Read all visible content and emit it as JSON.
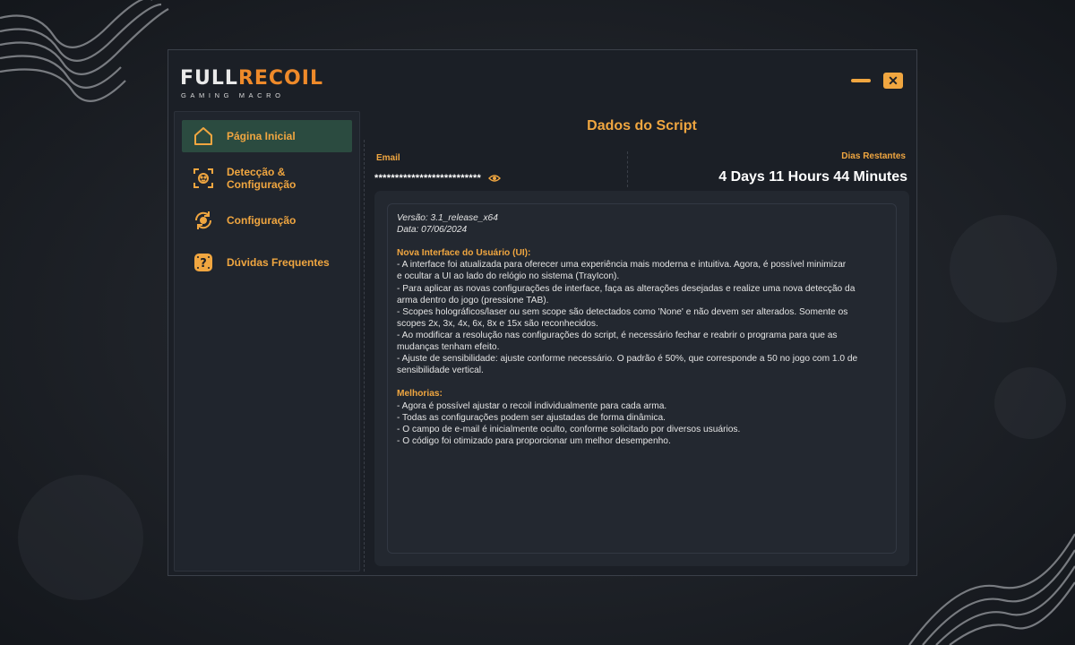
{
  "app": {
    "logo_full": "FULL",
    "logo_recoil": "RECOIL",
    "logo_sub": "GAMING MACRO",
    "close_symbol": "✕"
  },
  "sidebar": {
    "items": [
      {
        "label": "Página Inicial",
        "icon": "home-icon",
        "active": true
      },
      {
        "label": "Detecção & Configuração",
        "icon": "face-scan-icon",
        "active": false
      },
      {
        "label": "Configuração",
        "icon": "sync-gear-icon",
        "active": false
      },
      {
        "label": "Dúvidas Frequentes",
        "icon": "question-badge-icon",
        "active": false
      }
    ]
  },
  "main": {
    "title": "Dados do Script",
    "email_label": "Email",
    "email_value": "**************************",
    "days_label": "Dias Restantes",
    "days_value": "4 Days 11 Hours 44 Minutes",
    "notes": {
      "version": "Versão: 3.1_release_x64",
      "date": "Data: 07/06/2024",
      "ui_heading": "Nova Interface do Usuário (UI):",
      "ui_lines": [
        "- A interface foi atualizada para oferecer uma experiência mais moderna e intuitiva. Agora, é possível minimizar",
        "e ocultar a UI ao lado do relógio no sistema (TrayIcon).",
        "- Para aplicar as novas configurações de interface, faça as alterações desejadas e realize uma nova detecção da",
        "arma dentro do jogo (pressione TAB).",
        "- Scopes holográficos/laser ou sem scope são detectados como 'None' e não devem ser alterados. Somente os",
        "scopes 2x, 3x, 4x, 6x, 8x e 15x são reconhecidos.",
        "- Ao modificar a resolução nas configurações do script, é necessário fechar e reabrir o programa para que as",
        "mudanças tenham efeito.",
        "- Ajuste de sensibilidade: ajuste conforme necessário. O padrão é 50%, que corresponde a 50 no jogo com 1.0 de",
        "sensibilidade vertical."
      ],
      "improvements_heading": "Melhorias:",
      "improvement_lines": [
        "- Agora é possível ajustar o recoil individualmente para cada arma.",
        "- Todas as configurações podem ser ajustadas de forma dinâmica.",
        "- O campo de e-mail é inicialmente oculto, conforme solicitado por diversos usuários.",
        "- O código foi otimizado para proporcionar um melhor desempenho."
      ]
    }
  },
  "colors": {
    "accent": "#f0a640",
    "active_bg": "#2b4b40",
    "window_bg": "#1b1f26"
  }
}
